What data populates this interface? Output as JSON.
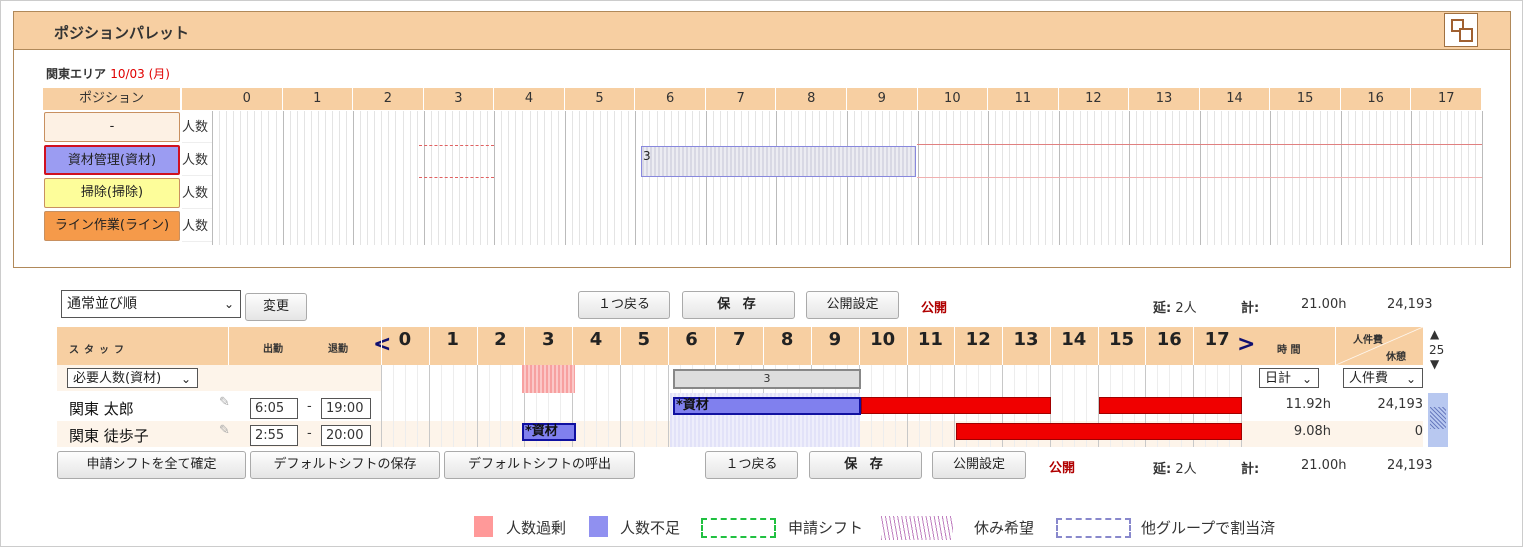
{
  "palette": {
    "title": "ポジションパレット",
    "area": "関東エリア",
    "date": "10/03 (月)",
    "col_header": "ポジション",
    "hours": [
      "0",
      "1",
      "2",
      "3",
      "4",
      "5",
      "6",
      "7",
      "8",
      "9",
      "10",
      "11",
      "12",
      "13",
      "14",
      "15",
      "16",
      "17"
    ],
    "row_suffix": "人数",
    "positions": [
      {
        "label": "-",
        "color": "#fdf1e4"
      },
      {
        "label": "資材管理(資材)",
        "color": "#9b9cf2"
      },
      {
        "label": "掃除(掃除)",
        "color": "#fdfd9a"
      },
      {
        "label": "ライン作業(ライン)",
        "color": "#f59a4a"
      }
    ],
    "block_value": "3"
  },
  "controls": {
    "sort_select": "通常並び順",
    "change_button": "変更",
    "undo_button": "１つ戻る",
    "save_button": "保 存",
    "publish_settings_button": "公開設定",
    "publish_status": "公開",
    "total_people_label": "延:",
    "total_people": "2人",
    "total_label": "計:",
    "total_hours": "21.00h",
    "total_cost": "24,193"
  },
  "grid": {
    "staff_header": "スタッフ",
    "in_header": "出勤",
    "out_header": "退勤",
    "hours": [
      "0",
      "1",
      "2",
      "3",
      "4",
      "5",
      "6",
      "7",
      "8",
      "9",
      "10",
      "11",
      "12",
      "13",
      "14",
      "15",
      "16",
      "17"
    ],
    "time_header": "時 間",
    "cost_header": "人件費",
    "break_header": "休憩",
    "scroll_value": "25",
    "required_select": "必要人数(資材)",
    "required_value": "3",
    "daily_select": "日計",
    "cost_select": "人件費",
    "staff": [
      {
        "name": "関東 太郎",
        "in": "6:05",
        "out": "19:00",
        "shift_label": "*資材",
        "hours": "11.92h",
        "cost": "24,193"
      },
      {
        "name": "関東 徒歩子",
        "in": "2:55",
        "out": "20:00",
        "shift_label": "*資材",
        "hours": "9.08h",
        "cost": "0"
      }
    ],
    "dash": "-"
  },
  "bottom": {
    "confirm_all_button": "申請シフトを全て確定",
    "save_default_button": "デフォルトシフトの保存",
    "load_default_button": "デフォルトシフトの呼出"
  },
  "legend": {
    "over": "人数過剰",
    "under": "人数不足",
    "request": "申請シフト",
    "holiday": "休み希望",
    "other_group": "他グループで割当済"
  }
}
